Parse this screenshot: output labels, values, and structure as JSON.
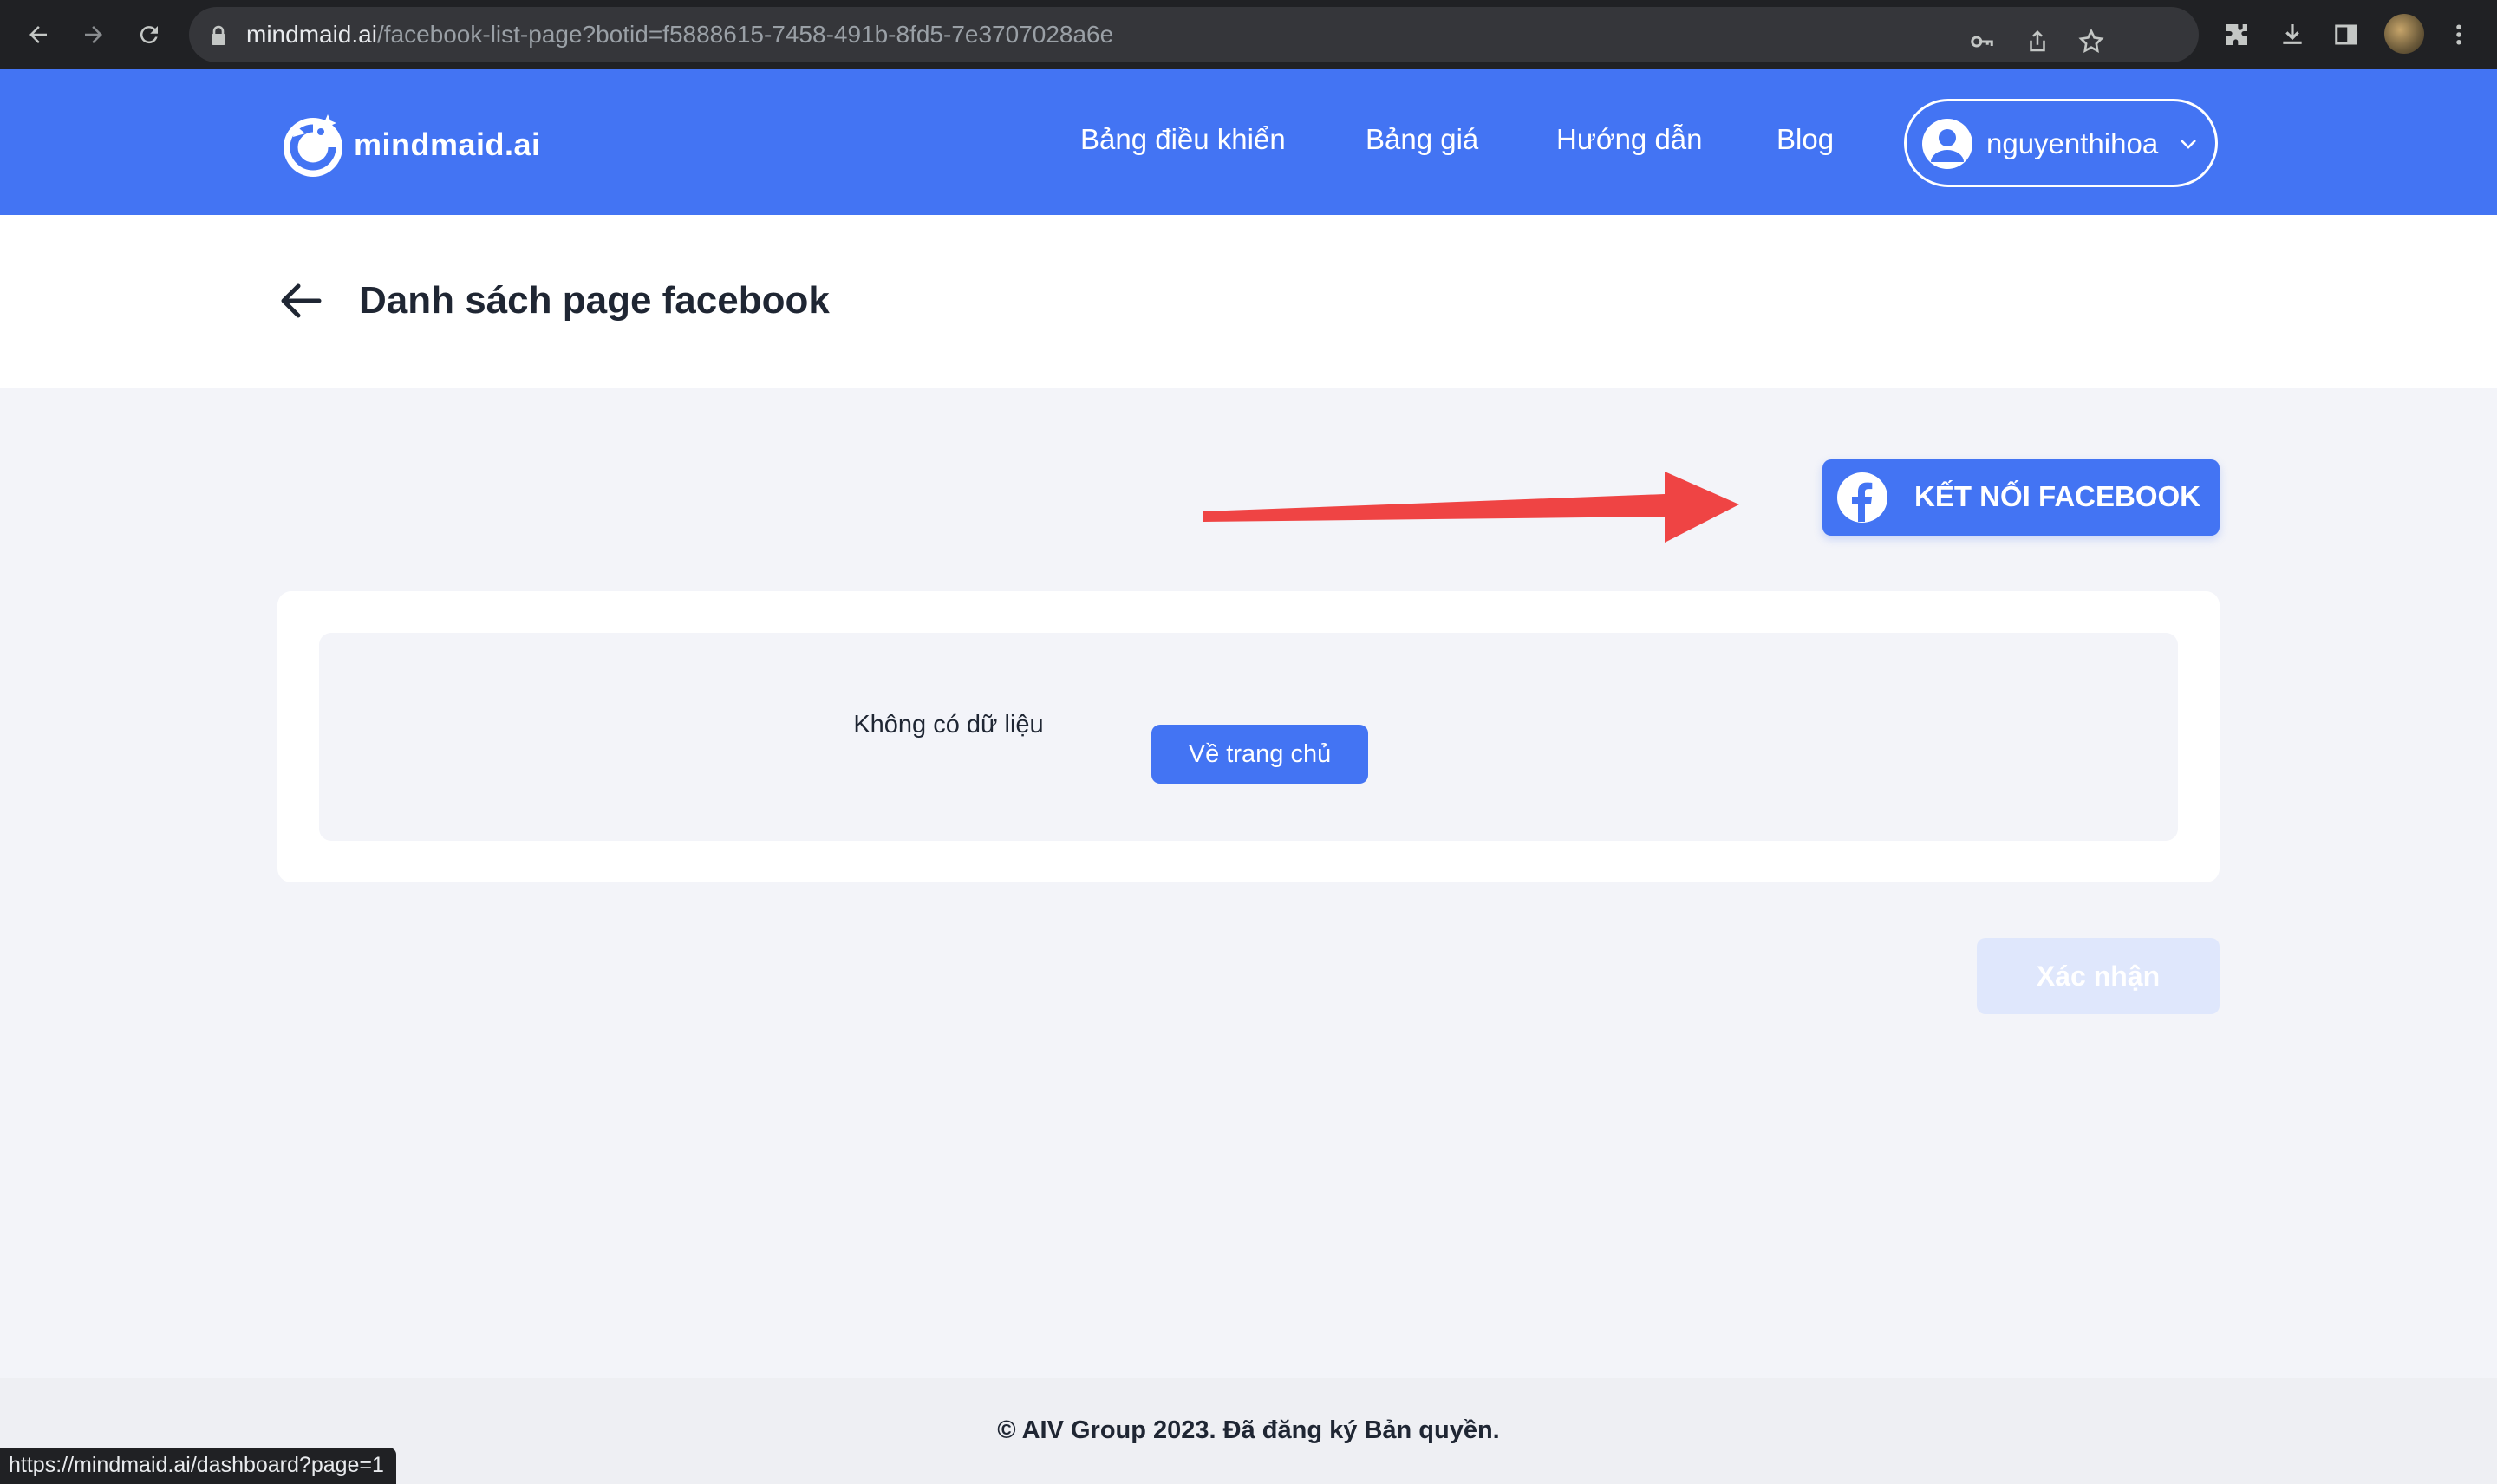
{
  "browser": {
    "url_host": "mindmaid.ai",
    "url_path": "/facebook-list-page?botid=f5888615-7458-491b-8fd5-7e3707028a6e",
    "status_url": "https://mindmaid.ai/dashboard?page=1"
  },
  "header": {
    "logo_text": "mindmaid.ai",
    "nav": [
      "Bảng điều khiển",
      "Bảng giá",
      "Hướng dẫn",
      "Blog"
    ],
    "username": "nguyenthihoa",
    "brand_color": "#4374f3"
  },
  "page": {
    "title": "Danh sách page facebook",
    "connect_button": "KẾT NỐI FACEBOOK",
    "empty_text": "Không có dữ liệu",
    "home_button": "Về trang chủ",
    "confirm_button": "Xác nhận"
  },
  "footer": {
    "text": "© AIV Group 2023. Đã đăng ký Bản quyền."
  },
  "annotation": {
    "arrow_color": "#ef4444"
  }
}
